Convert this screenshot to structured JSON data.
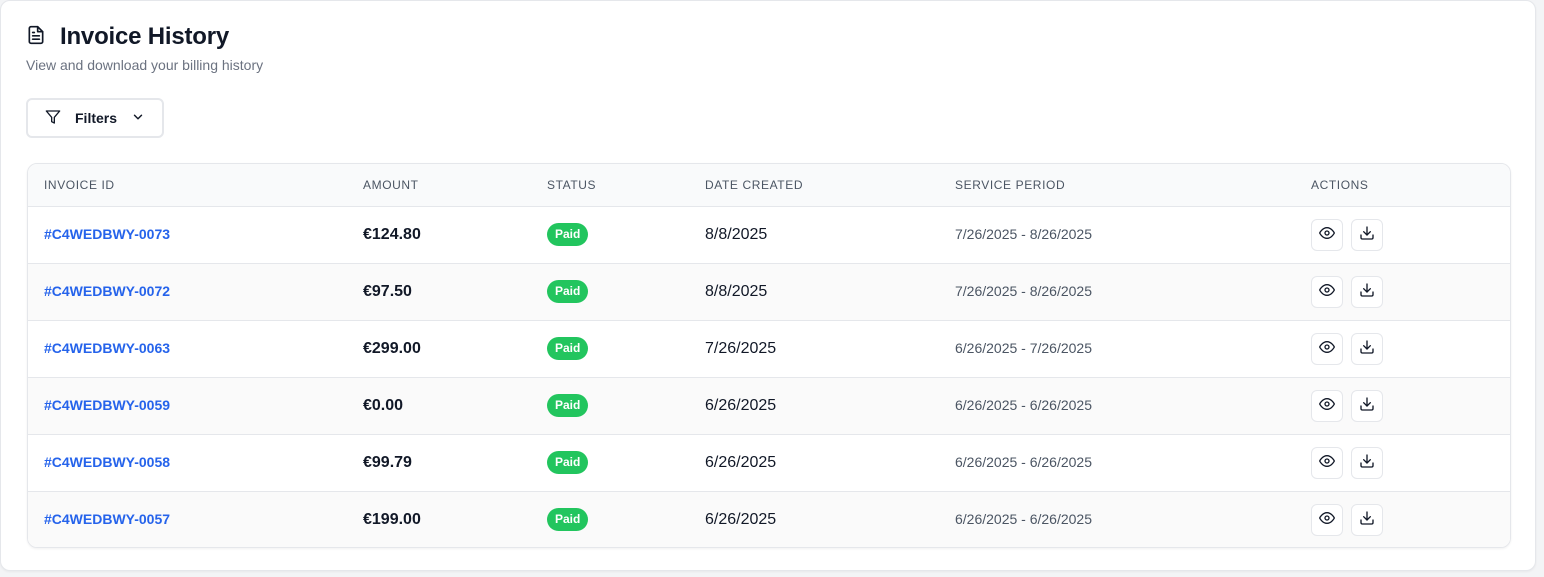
{
  "header": {
    "title": "Invoice History",
    "subtitle": "View and download your billing history",
    "icon": "document-icon"
  },
  "filters": {
    "label": "Filters",
    "icon": "filter-icon",
    "chevron": "chevron-down-icon"
  },
  "table": {
    "columns": [
      "INVOICE ID",
      "AMOUNT",
      "STATUS",
      "DATE CREATED",
      "SERVICE PERIOD",
      "ACTIONS"
    ],
    "rows": [
      {
        "id": "#C4WEDBWY-0073",
        "amount": "€124.80",
        "status": "Paid",
        "date": "8/8/2025",
        "period": "7/26/2025 - 8/26/2025"
      },
      {
        "id": "#C4WEDBWY-0072",
        "amount": "€97.50",
        "status": "Paid",
        "date": "8/8/2025",
        "period": "7/26/2025 - 8/26/2025"
      },
      {
        "id": "#C4WEDBWY-0063",
        "amount": "€299.00",
        "status": "Paid",
        "date": "7/26/2025",
        "period": "6/26/2025 - 7/26/2025"
      },
      {
        "id": "#C4WEDBWY-0059",
        "amount": "€0.00",
        "status": "Paid",
        "date": "6/26/2025",
        "period": "6/26/2025 - 6/26/2025"
      },
      {
        "id": "#C4WEDBWY-0058",
        "amount": "€99.79",
        "status": "Paid",
        "date": "6/26/2025",
        "period": "6/26/2025 - 6/26/2025"
      },
      {
        "id": "#C4WEDBWY-0057",
        "amount": "€199.00",
        "status": "Paid",
        "date": "6/26/2025",
        "period": "6/26/2025 - 6/26/2025"
      }
    ],
    "actions": {
      "view_icon": "eye-icon",
      "download_icon": "download-icon"
    }
  },
  "colors": {
    "link": "#2563eb",
    "paid_badge": "#22c55e"
  }
}
